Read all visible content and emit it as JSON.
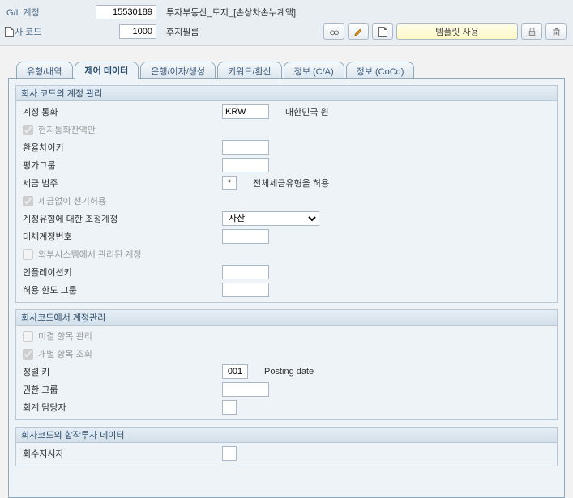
{
  "header": {
    "gl_label": "G/L 계정",
    "gl_value": "15530189",
    "gl_desc": "투자부동산_토지_[손상차손누계액]",
    "cc_label": "회사 코드",
    "cc_value": "1000",
    "cc_desc": "후지필름",
    "template_btn": "템플릿 사용"
  },
  "tabs": {
    "t1": "유형/내역",
    "t2": "제어 데이터",
    "t3": "은행/이자/생성",
    "t4": "키워드/환산",
    "t5": "정보 (C/A)",
    "t6": "정보 (CoCd)"
  },
  "group1": {
    "title": "회사 코드의 계정 관리",
    "currency_label": "계정 통화",
    "currency_value": "KRW",
    "currency_desc": "대한민국 원",
    "local_only": "현지통화잔액만",
    "exch_key": "환율차이키",
    "val_group": "평가그룹",
    "tax_cat_label": "세금 범주",
    "tax_cat_value": "*",
    "tax_cat_desc": "전체세금유형을 허용",
    "post_wo_tax": "세금없이 전기허용",
    "recon_label": "계정유형에 대한 조정계정",
    "recon_value": "자산",
    "alt_no": "대체계정번호",
    "ext_managed": "외부시스템에서 관리된 계정",
    "infl_key": "인플레이션키",
    "tol_group": "허용 한도 그룹"
  },
  "group2": {
    "title": "회사코드에서 계정관리",
    "open_item": "미결 항목 관리",
    "line_item": "개별 항목 조회",
    "sort_label": "정렬 키",
    "sort_value": "001",
    "sort_desc": "Posting date",
    "auth_group": "권한 그룹",
    "clerk": "회계 담당자"
  },
  "group3": {
    "title": "회사코드의 합작투자 데이터",
    "recovery": "회수지시자"
  }
}
